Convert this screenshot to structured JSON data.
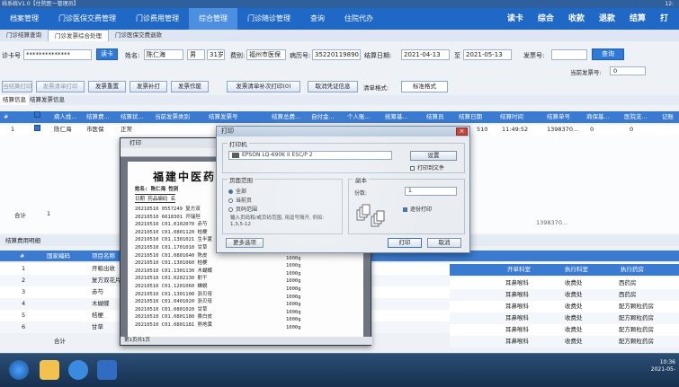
{
  "window": {
    "title": "线系统V1.0【住院医一管理员】",
    "clock": "12:"
  },
  "nav": {
    "tabs": [
      "档案管理",
      "门诊医保交费管理",
      "门诊费用管理",
      "综合管理",
      "门诊随诊管理",
      "查询",
      "住院代办"
    ],
    "right_items": [
      "读卡",
      "综合",
      "收款",
      "退款",
      "结算",
      "打"
    ]
  },
  "subtabs": [
    "门诊结算查询",
    "门诊发票综合处理",
    "门诊医保交费退款"
  ],
  "form": {
    "card_label": "诊卡号",
    "card_value": "**************",
    "read_card_btn": "读卡",
    "name_label": "姓名:",
    "name_value": "陈仁海",
    "sex_value": "男",
    "age_value": "31岁",
    "fee_type_label": "费别:",
    "fee_type_value": "福州市医保",
    "case_no_label": "病历号:",
    "case_no_value": "35220119890",
    "settle_date_label": "结算日期:",
    "date_from": "2021-04-13",
    "date_to_label": "至",
    "date_to": "2021-05-13",
    "invoice_no_label": "发票号:",
    "query_btn": "查询",
    "current_invoice_label": "当前发票号:",
    "current_invoice_value": "0"
  },
  "toolbar": {
    "buttons": [
      "当结算打印",
      "发票清单打印",
      "发票重置",
      "发票补打",
      "发票作废",
      "发票清单补次打印(0)",
      "取消凭证信息",
      "清单格式:",
      "标准格式"
    ]
  },
  "grid": {
    "tabs": [
      "结算信息",
      "结算发票信息"
    ],
    "headers": [
      "病人姓...",
      "结算费...",
      "结算状...",
      "当前发票类别",
      "结算发票号",
      "结算总费...",
      "自付金...",
      "个人账...",
      "统筹基...",
      "结算员",
      "结算日期",
      "结算时间",
      "结算单号",
      "商保基...",
      "医院支...",
      "记账"
    ],
    "rows": [
      {
        "no": "1",
        "name": "陈仁海",
        "fee": "市医保",
        "status": "正常",
        "date": "510",
        "time": "11:49:52",
        "bill": "1398370...",
        "a": "0",
        "b": "0"
      }
    ],
    "total_label": "合计",
    "total_value": "1",
    "total_bill": "1398370..."
  },
  "bottom": {
    "title": "结算费用明细",
    "headers": [
      "#",
      "国家编码",
      "项目名称"
    ],
    "rows": [
      {
        "no": "1",
        "name": "开粮出收"
      },
      {
        "no": "2",
        "name": "复方双花片"
      },
      {
        "no": "3",
        "name": "赤芍"
      },
      {
        "no": "4",
        "name": "木蝴蝶"
      },
      {
        "no": "5",
        "name": "桔梗"
      },
      {
        "no": "6",
        "name": "甘草"
      },
      {
        "no": "7",
        "name": "合计"
      }
    ],
    "right_headers": [
      "开单科室",
      "执行科室",
      "执行药房"
    ],
    "right_rows": [
      {
        "open": "耳鼻喉科",
        "exec": "收费处",
        "pharm": "西药房"
      },
      {
        "open": "耳鼻喉科",
        "exec": "收费处",
        "pharm": "西药房"
      },
      {
        "open": "耳鼻喉科",
        "exec": "收费处",
        "pharm": "配方颗粒药房"
      },
      {
        "open": "耳鼻喉科",
        "exec": "收费处",
        "pharm": "配方颗粒药房"
      },
      {
        "open": "耳鼻喉科",
        "exec": "收费处",
        "pharm": "配方颗粒药房"
      },
      {
        "open": "耳鼻喉科",
        "exec": "收费处",
        "pharm": "配方颗粒药房"
      }
    ]
  },
  "preview": {
    "title": "打印",
    "hospital": "福建中医药大学",
    "name_line": "姓名:  陈仁海    性别",
    "header_line": "日期      药品编码      名",
    "items": [
      "20210510  0557249   复方双",
      "20210510  6618301   开瑞坦",
      "20210510  C01.0102070  赤芍",
      "20210510  C01.0801120  桔梗",
      "20210510  C01.1301021  生半夏",
      "20210510  C01.1701010  甘草",
      "20210510  C01.0801640  陈皮",
      "20210510  C01.1301060  桔梗",
      "20210510  C01.1301130  木蝴蝶",
      "20210510  C01.0202130  射干",
      "20210510  C01.1201060  蝉蜕",
      "20210510  C01.1301100  浙贝母",
      "20210510  C01.0401020  浙贝母",
      "20210510  C01.0801020  甘草",
      "20210510  C01.0801180  桑白皮",
      "20210510  C01.0801181  熟地黄"
    ],
    "amounts": [
      "1000g",
      "1000g",
      "1000g",
      "1000g",
      "1000g",
      "1000g",
      "1000g",
      "1000g",
      "1000g",
      "1000g",
      "1000g"
    ],
    "status": "第1页共1页"
  },
  "dialog": {
    "title": "打印",
    "printer_label": "打印机",
    "printer_name": "EPSON LQ-690K II ESC/P 2",
    "settings_btn": "设置",
    "print_to_file": "打印到文件",
    "range_label": "页面范围",
    "range_all": "全部",
    "range_current": "当前页",
    "range_pages": "页码范围",
    "range_hint": "输入页码和/或页码范围, 用逗号隔开, 例如: 1,3,5-12",
    "copies_label": "副本",
    "copies_count_label": "份数:",
    "copies_value": "1",
    "collate": "逐份打印",
    "more_options": "更多选项",
    "print_btn": "打印",
    "cancel_btn": "取消"
  },
  "taskbar": {
    "time": "10:36",
    "date": "2021-05-"
  }
}
